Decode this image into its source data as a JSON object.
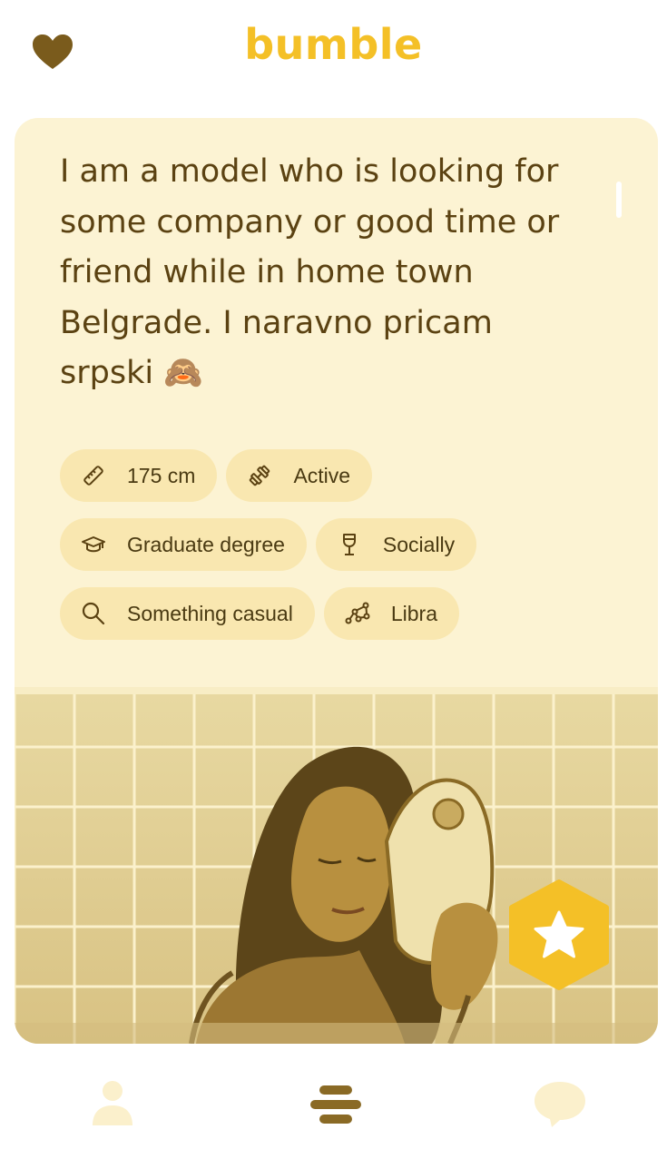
{
  "header": {
    "brand": "bumble",
    "brand_color": "#f4c027",
    "left_icon": "heart-icon"
  },
  "profile": {
    "bio": "I am a model who is looking for some company or good time or friend while in home town Belgrade. I naravno pricam srpski 🙈",
    "chips": [
      [
        {
          "icon": "ruler-icon",
          "label": "175 cm"
        },
        {
          "icon": "dumbbell-icon",
          "label": "Active"
        }
      ],
      [
        {
          "icon": "graduation-cap-icon",
          "label": "Graduate degree"
        },
        {
          "icon": "wine-glass-icon",
          "label": "Socially"
        }
      ],
      [
        {
          "icon": "search-icon",
          "label": "Something casual"
        },
        {
          "icon": "constellation-icon",
          "label": "Libra"
        }
      ]
    ],
    "photo_description_icon": "profile-photo",
    "superswipe_icon": "star-icon"
  },
  "bottom_nav": {
    "items": [
      {
        "icon": "profile-icon"
      },
      {
        "icon": "swipe-stack-icon"
      },
      {
        "icon": "chat-bubble-icon"
      }
    ]
  },
  "colors": {
    "card_bg": "#fcf3d3",
    "chip_bg": "#f9e7b0",
    "text": "#5b4212",
    "accent": "#f4c027",
    "icon_dark": "#8a6a25"
  }
}
